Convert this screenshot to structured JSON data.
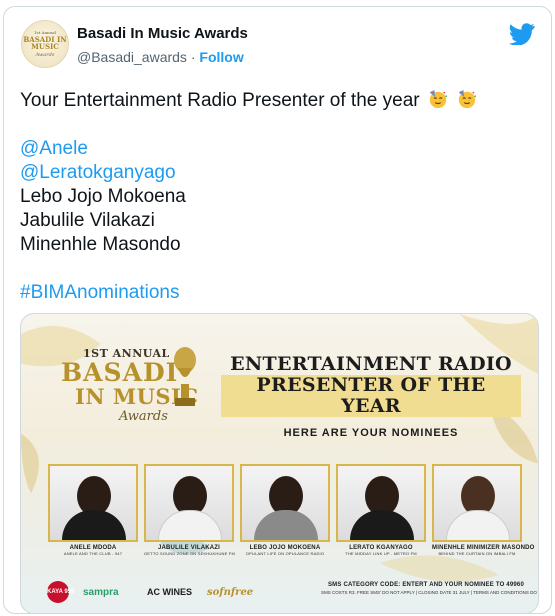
{
  "header": {
    "display_name": "Basadi In Music Awards",
    "handle": "@Basadi_awards",
    "separator": "·",
    "follow_label": "Follow",
    "brand_color": "#1d9bf0",
    "avatar_lines": [
      "1st Annual",
      "BASADI IN MUSIC",
      "Awards"
    ],
    "platform_icon": "twitter-bird-icon"
  },
  "tweet": {
    "line1": "Your Entertainment Radio Presenter of the year",
    "line1_emojis": [
      "partying-face-emoji",
      "partying-face-emoji"
    ],
    "mentions": [
      "@Anele",
      "@Leratokganyago"
    ],
    "names": [
      "Lebo Jojo Mokoena",
      "Jabulile Vilakazi",
      "Minenhle Masondo"
    ],
    "hashtag": "#BIMAnominations"
  },
  "media": {
    "logo": {
      "annual": "1ST ANNUAL",
      "basadi": "BASADI",
      "in_music": "IN MUSIC",
      "awards": "Awards"
    },
    "headline_1": "ENTERTAINMENT RADIO",
    "headline_2": "PRESENTER OF THE YEAR",
    "subheadline": "HERE ARE YOUR NOMINEES",
    "nominees": [
      {
        "name": "ANELE MDODA",
        "show": "ANELE AND THE CLUB - 947"
      },
      {
        "name": "JABULILE VILAKAZI",
        "show": "GETTO SOUND ZONE ON SEKHUKHUNE FM"
      },
      {
        "name": "LEBO JOJO MOKOENA",
        "show": "OPULANT LIFE ON OPULANCE RADIO"
      },
      {
        "name": "LERATO KGANYAGO",
        "show": "THE MIDDAY LINK UP - METRO FM"
      },
      {
        "name": "MINENHLE MINIMIZER MASONDO",
        "show": "BEHIND THE CURTAIN ON IMBALI FM"
      }
    ],
    "sponsors": [
      "KAYA 959",
      "sampra",
      "AC WINES",
      "sofnfree"
    ],
    "sms_line_1": "SMS CATEGORY CODE: ENTERT AND YOUR NOMINEE TO 49960",
    "sms_line_2": "SMS COSTS R3. FREE SMS' DO NOT APPLY  |  CLOSING DATE 31 JULY  |  TERMS AND CONDITIONS DO APPLY",
    "gold": "#b7912b"
  }
}
